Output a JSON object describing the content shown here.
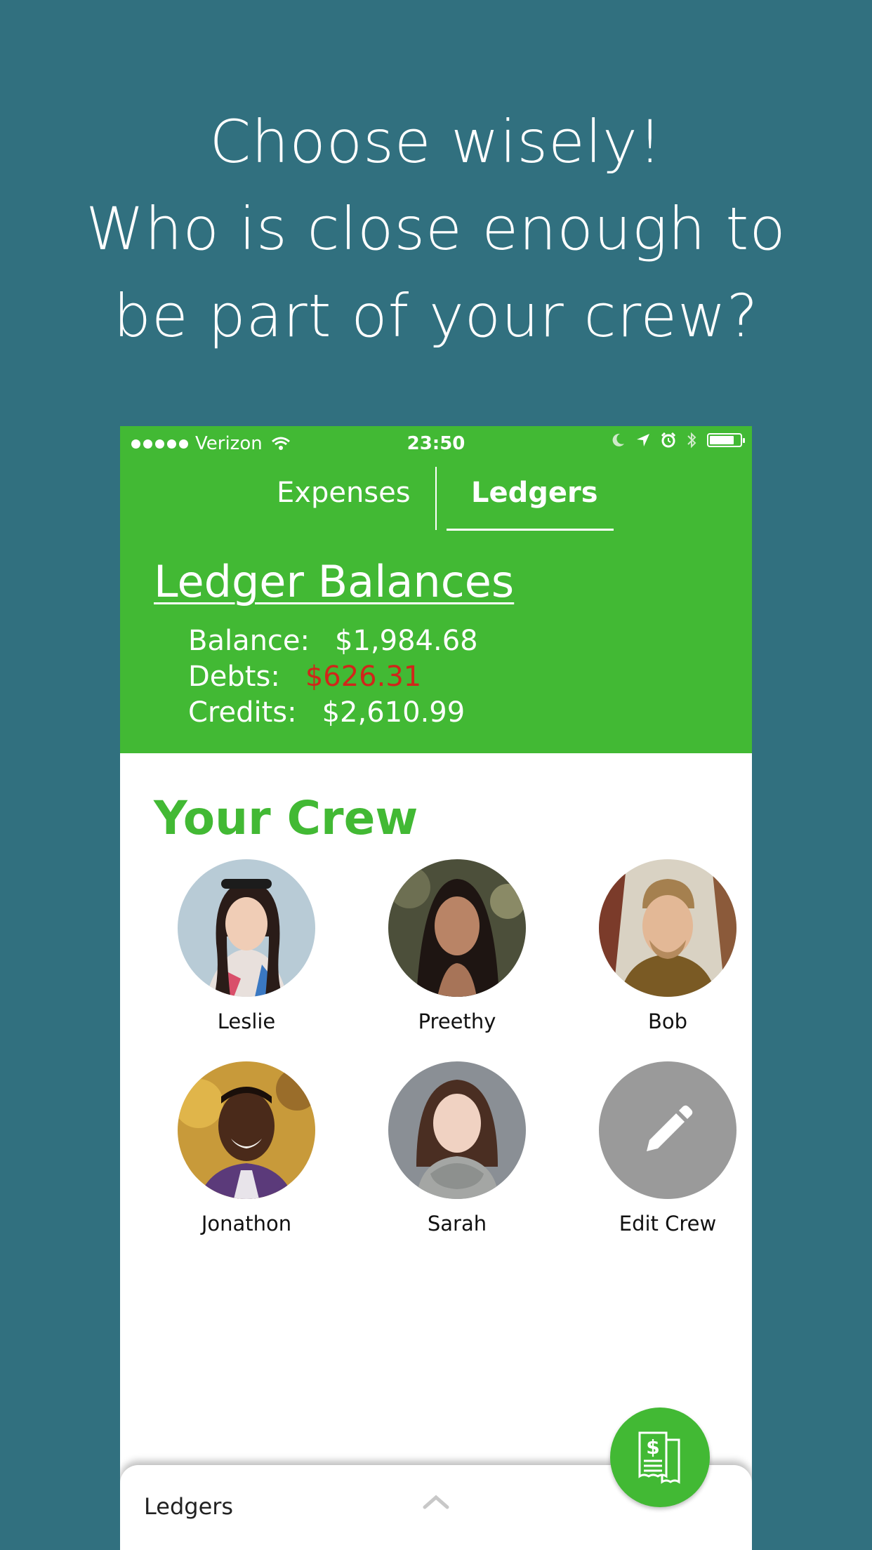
{
  "headline": {
    "line1": "Choose wisely!",
    "line2": "Who is close enough to",
    "line3": "be part of your crew?"
  },
  "status_bar": {
    "carrier": "Verizon",
    "time": "23:50",
    "icons": [
      "signal-dots-icon",
      "wifi-icon",
      "moon-icon",
      "location-icon",
      "alarm-icon",
      "bluetooth-icon",
      "battery-icon"
    ]
  },
  "tabs": [
    {
      "label": "Expenses",
      "active": false
    },
    {
      "label": "Ledgers",
      "active": true
    }
  ],
  "ledger": {
    "title": "Ledger Balances",
    "balance_label": "Balance:",
    "balance_value": "$1,984.68",
    "debts_label": "Debts:",
    "debts_value": "$626.31",
    "credits_label": "Credits:",
    "credits_value": "$2,610.99"
  },
  "crew": {
    "title": "Your Crew",
    "members": [
      {
        "name": "Leslie"
      },
      {
        "name": "Preethy"
      },
      {
        "name": "Bob"
      },
      {
        "name": "Jonathon"
      },
      {
        "name": "Sarah"
      }
    ],
    "edit_label": "Edit Crew"
  },
  "bottom_sheet": {
    "label": "Ledgers"
  },
  "colors": {
    "background": "#31707f",
    "brand_green": "#42b934",
    "debt_red": "#d0261a",
    "edit_gray": "#9a9a9a"
  }
}
